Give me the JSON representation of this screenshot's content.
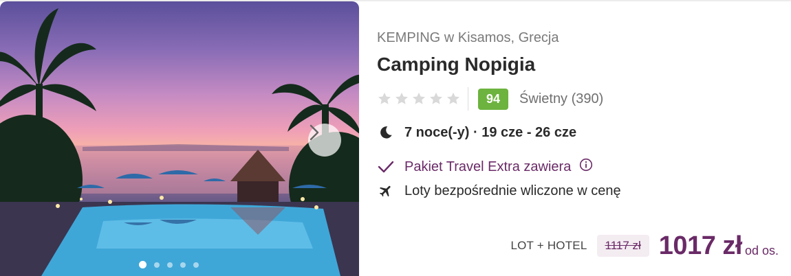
{
  "hotel": {
    "location": "KEMPING w Kisamos, Grecja",
    "name": "Camping Nopigia",
    "stars_count": 5,
    "score": "94",
    "score_label": "Świetny (390)",
    "dates": "7 noce(-y) · 19 cze - 26 cze",
    "extra_package": "Pakiet Travel Extra zawiera",
    "flights": "Loty bezpośrednie wliczone w cenę"
  },
  "price": {
    "package_type": "LOT + HOTEL",
    "old": "1117 zł",
    "current": "1017 zł",
    "per_person": "od os."
  },
  "gallery": {
    "slides": 5,
    "active_slide": 1
  },
  "colors": {
    "accent": "#6a2a67",
    "score_bg": "#6db33f",
    "star_empty": "#d9d9d9"
  },
  "icons": {
    "dates": "moon-icon",
    "extra": "checkmark-icon",
    "extra_info": "info-circle-icon",
    "flights": "airplane-icon",
    "gallery_next": "chevron-right-icon"
  }
}
